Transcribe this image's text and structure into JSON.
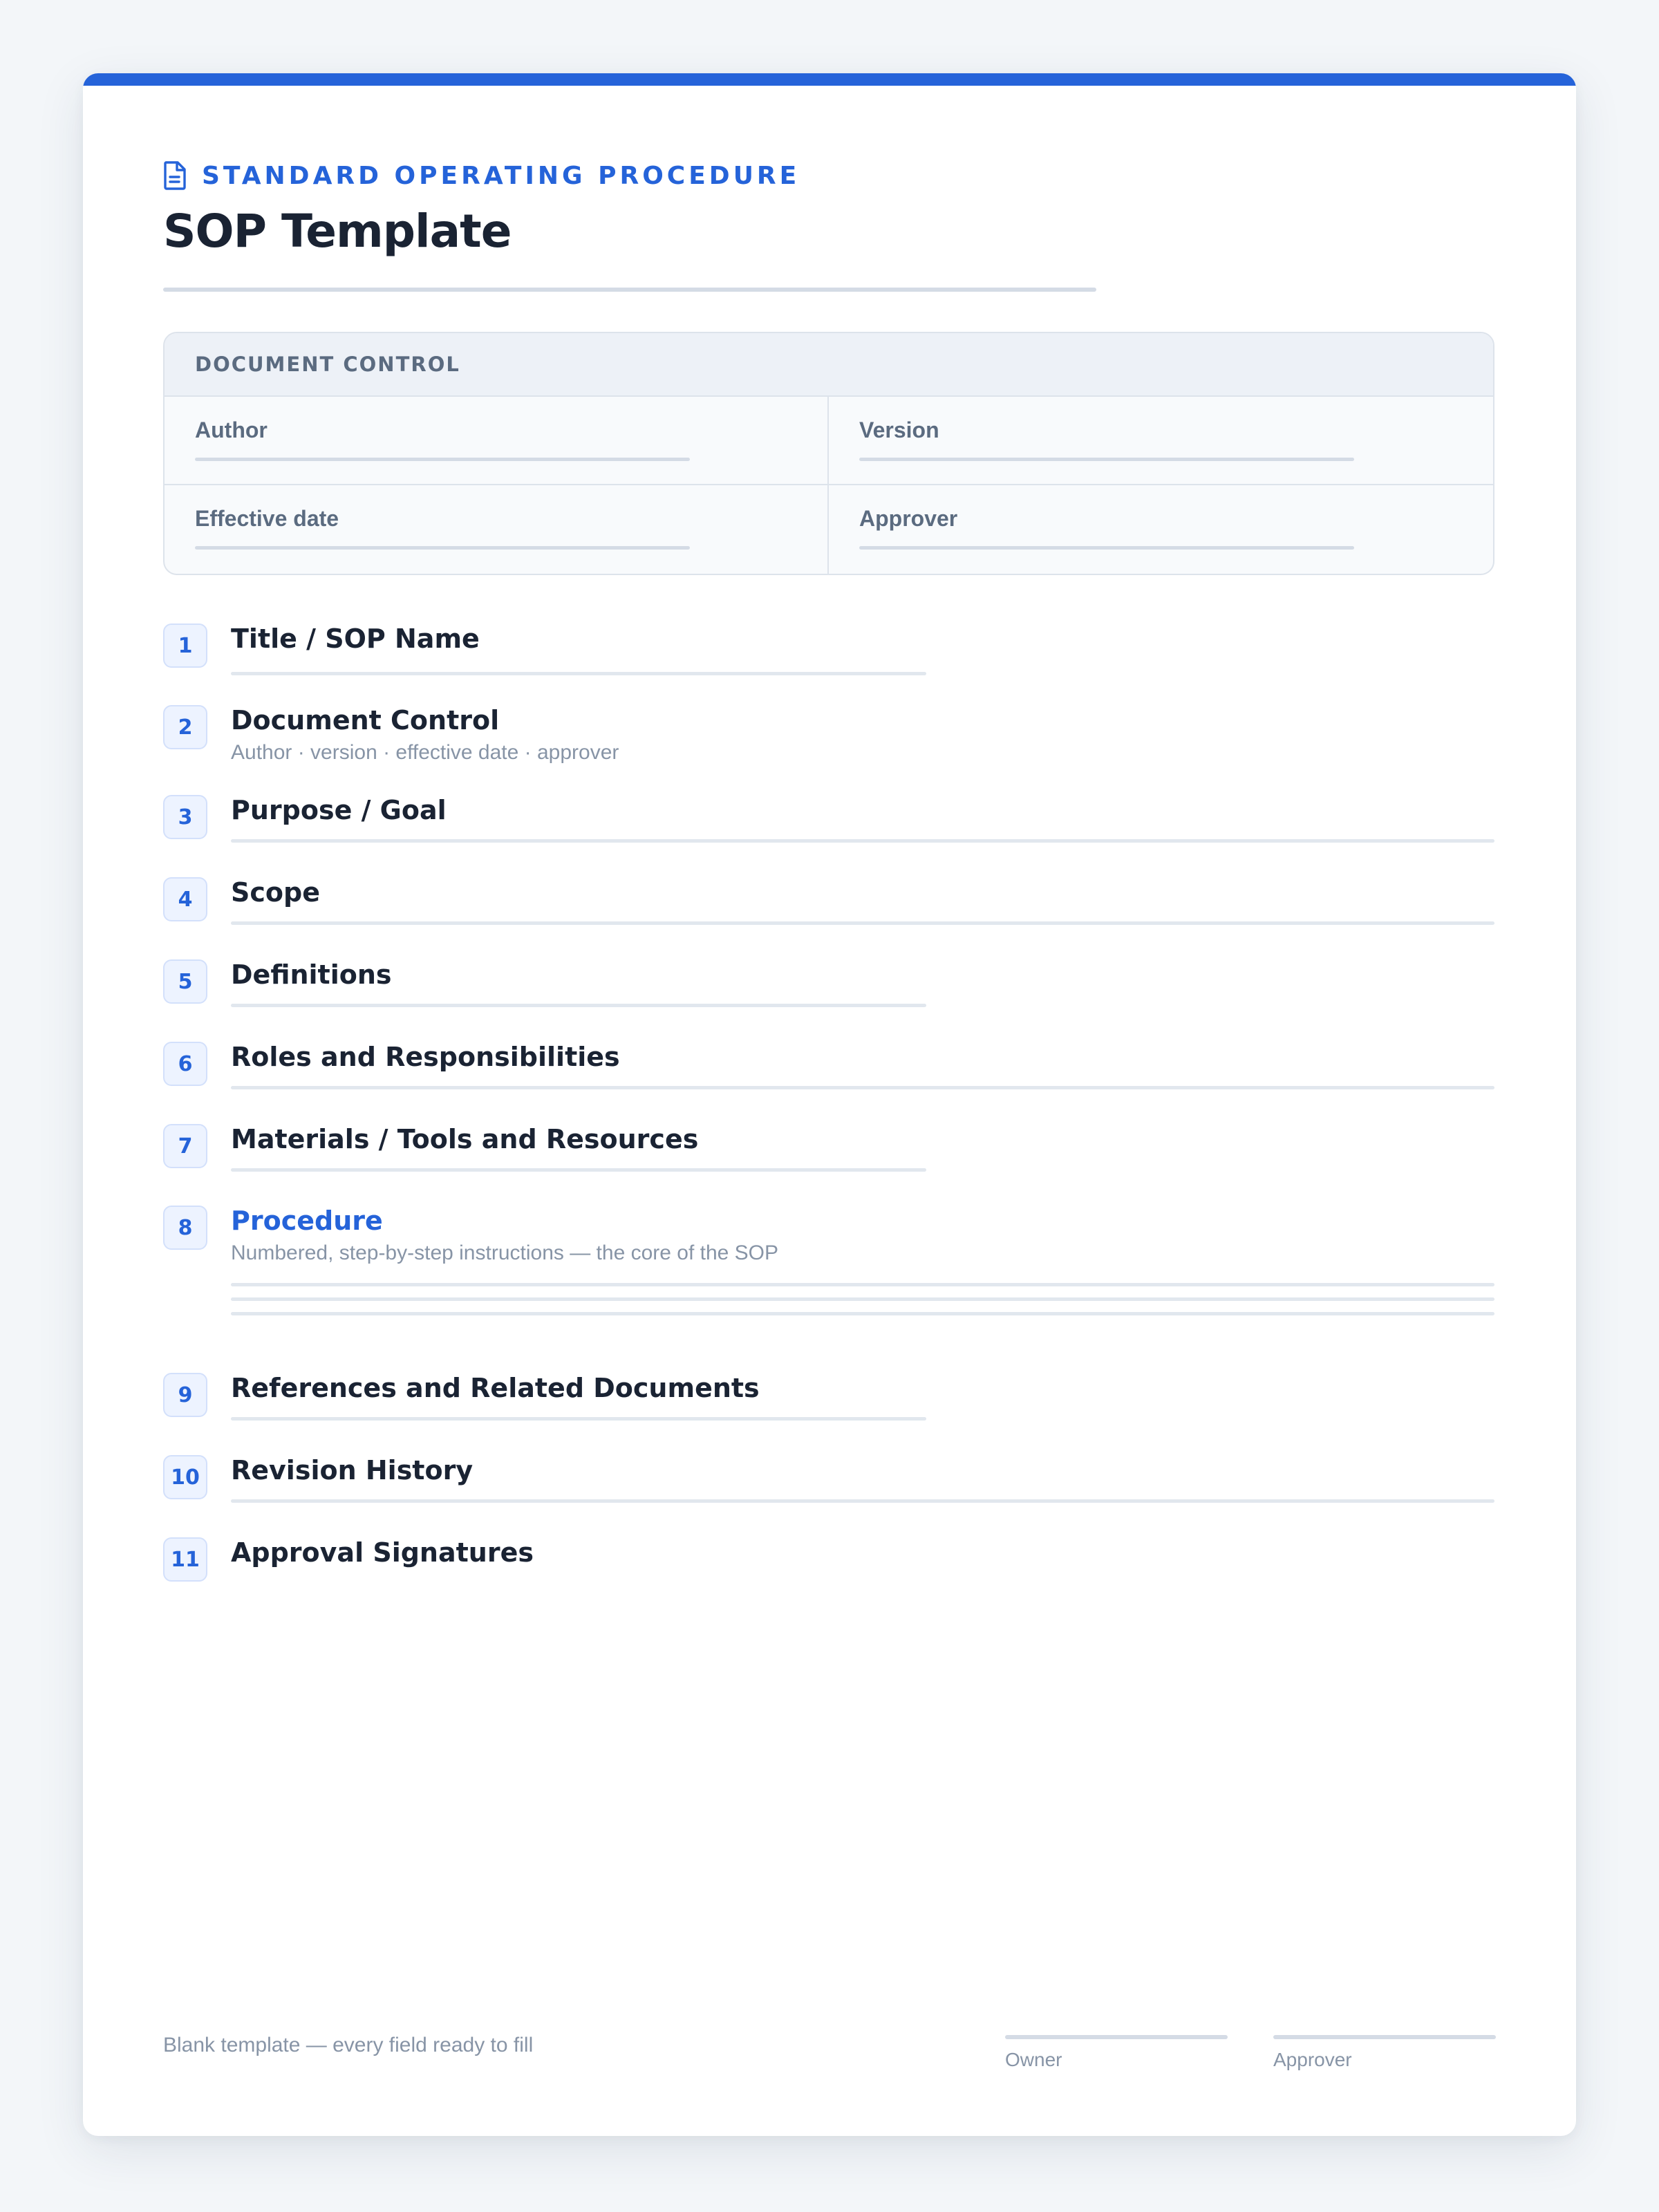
{
  "header": {
    "eyebrow": "STANDARD OPERATING PROCEDURE",
    "title": "SOP Template",
    "icon": "document-icon",
    "accent_color": "#2563d9"
  },
  "document_control": {
    "heading": "DOCUMENT CONTROL",
    "fields": [
      {
        "label": "Author"
      },
      {
        "label": "Version"
      },
      {
        "label": "Effective date"
      },
      {
        "label": "Approver"
      }
    ]
  },
  "sections": [
    {
      "number": "1",
      "title": "Title / SOP Name"
    },
    {
      "number": "2",
      "title": "Document Control",
      "subtitle": "Author · version · effective date · approver"
    },
    {
      "number": "3",
      "title": "Purpose / Goal"
    },
    {
      "number": "4",
      "title": "Scope"
    },
    {
      "number": "5",
      "title": "Definitions"
    },
    {
      "number": "6",
      "title": "Roles and Responsibilities"
    },
    {
      "number": "7",
      "title": "Materials / Tools and Resources"
    },
    {
      "number": "8",
      "title": "Procedure",
      "subtitle": "Numbered, step-by-step instructions — the core of the SOP",
      "highlighted": true
    },
    {
      "number": "9",
      "title": "References and Related Documents"
    },
    {
      "number": "10",
      "title": "Revision History"
    },
    {
      "number": "11",
      "title": "Approval Signatures"
    }
  ],
  "footer": {
    "note": "Blank template — every field ready to fill",
    "signatures": [
      {
        "label": "Owner"
      },
      {
        "label": "Approver"
      }
    ]
  }
}
